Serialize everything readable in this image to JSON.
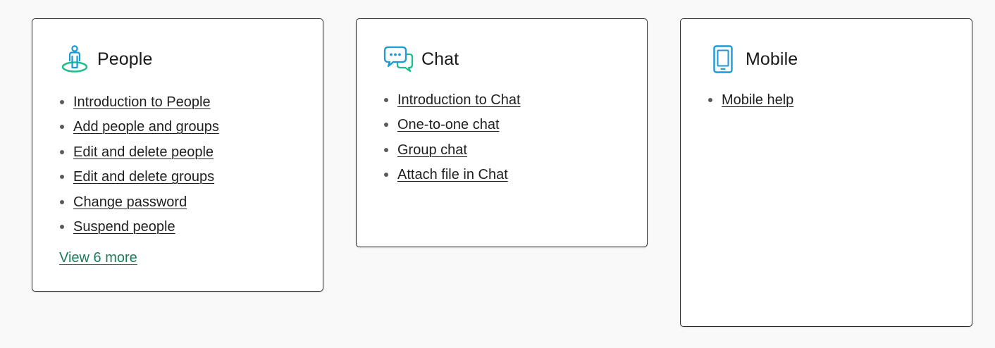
{
  "colors": {
    "accent_green": "#1e7a58",
    "icon_blue": "#1a9ad6",
    "icon_green": "#1bbf89"
  },
  "cards": [
    {
      "title": "People",
      "icon": "person-on-platform-icon",
      "links": [
        "Introduction to People",
        "Add people and groups",
        "Edit and delete people",
        "Edit and delete groups",
        "Change password",
        "Suspend people"
      ],
      "view_more": "View 6 more"
    },
    {
      "title": "Chat",
      "icon": "chat-bubbles-icon",
      "links": [
        "Introduction to Chat",
        "One-to-one chat",
        "Group chat",
        "Attach file in Chat"
      ]
    },
    {
      "title": "Mobile",
      "icon": "mobile-phone-icon",
      "links": [
        "Mobile help"
      ]
    }
  ]
}
